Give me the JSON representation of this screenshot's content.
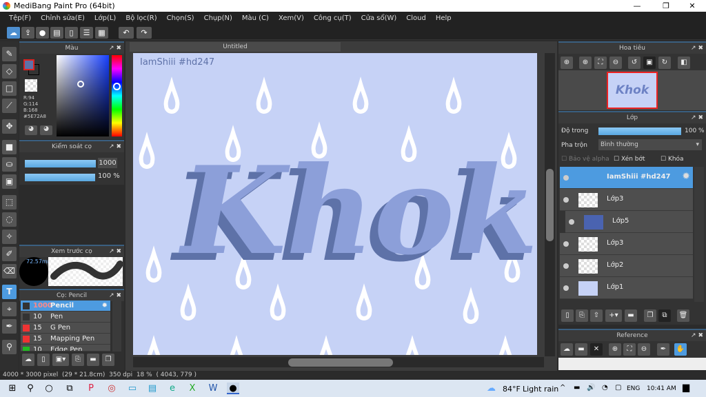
{
  "window": {
    "title": "MediBang Paint Pro (64bit)",
    "minimize": "—",
    "maximize": "❐",
    "close": "✕"
  },
  "menu": [
    "Tệp(F)",
    "Chỉnh sửa(E)",
    "Lớp(L)",
    "Bộ lọc(R)",
    "Chọn(S)",
    "Chụp(N)",
    "Màu (C)",
    "Xem(V)",
    "Công cụ(T)",
    "Cửa sổ(W)",
    "Cloud",
    "Help"
  ],
  "color_panel": {
    "title": "Màu",
    "r": "R:94",
    "g": "G:114",
    "b": "B:168",
    "hex": "#5E72A8",
    "primary": "#5e72a8",
    "secondary": "#5e72a8"
  },
  "brush_control": {
    "title": "Kiểm soát cọ",
    "size": "1000",
    "opacity": "100 %",
    "size_fraction": 1.0,
    "opacity_percent": 100
  },
  "brush_preview": {
    "title": "Xem trước cọ",
    "size": "72.57mm"
  },
  "brush_list": {
    "title": "Cọ: Pencil",
    "items": [
      {
        "size": "1000",
        "name": "Pencil",
        "color": "#333333",
        "selected": true
      },
      {
        "size": "10",
        "name": "Pen",
        "color": "#333333"
      },
      {
        "size": "15",
        "name": "G Pen",
        "color": "#ee3333"
      },
      {
        "size": "15",
        "name": "Mapping Pen",
        "color": "#ee3333"
      },
      {
        "size": "10",
        "name": "Edge Pen",
        "color": "#22bb22"
      }
    ]
  },
  "document": {
    "tab": "Untitled",
    "watermark": "IamShiii #hd247",
    "artwork_text": "Khok",
    "background": "#c6d2f6"
  },
  "navigator": {
    "title": "Hoa tiêu"
  },
  "layers_panel": {
    "title": "Lớp",
    "opacity_label": "Độ trong",
    "opacity": "100 %",
    "opacity_percent": 100,
    "blend_label": "Pha trộn",
    "blend_value": "Bình thường",
    "protect_alpha": "Bảo vệ alpha",
    "clipping": "Xén bớt",
    "lock": "Khóa",
    "layers": [
      {
        "name": "IamShiii #hd247",
        "selected": true
      },
      {
        "name": "Lớp3"
      },
      {
        "name": "Lớp5",
        "clipped": true
      },
      {
        "name": "Lớp3"
      },
      {
        "name": "Lớp2"
      },
      {
        "name": "Lớp1"
      }
    ]
  },
  "reference": {
    "title": "Reference"
  },
  "status": {
    "size": "4000 * 3000 pixel",
    "dims": "(29 * 21.8cm)",
    "dpi": "350 dpi",
    "zoom": "18 %",
    "coords": "( 4043, 779 )"
  },
  "taskbar": {
    "weather_temp": "84°F",
    "weather_text": "Light rain",
    "lang": "ENG",
    "time": "10:41 AM"
  }
}
